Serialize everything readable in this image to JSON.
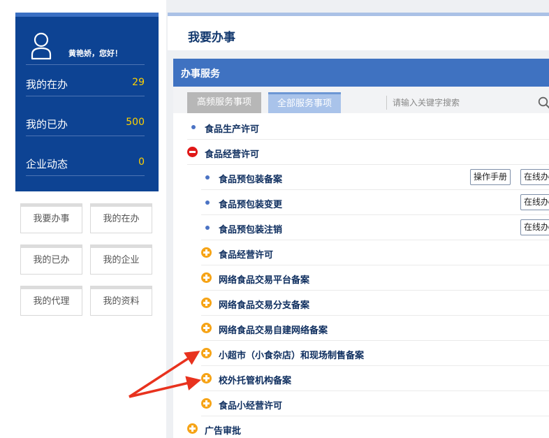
{
  "user": {
    "greeting": "黄艳娇，您好！",
    "stats": [
      {
        "label": "我的在办",
        "value": "29"
      },
      {
        "label": "我的已办",
        "value": "500"
      },
      {
        "label": "企业动态",
        "value": "0"
      }
    ]
  },
  "nav_buttons": [
    "我要办事",
    "我的在办",
    "我的已办",
    "我的企业",
    "我的代理",
    "我的资料"
  ],
  "page_title": "我要办事",
  "panel": {
    "title": "办事服务",
    "tabs": [
      {
        "label": "高频服务事项",
        "active": false
      },
      {
        "label": "全部服务事项",
        "active": true
      }
    ],
    "search_placeholder": "请输入关键字搜索"
  },
  "tree": [
    {
      "label": "食品生产许可",
      "type": "dot",
      "level": 0,
      "buttons": []
    },
    {
      "label": "食品经营许可",
      "type": "minus",
      "level": 0,
      "buttons": []
    },
    {
      "label": "食品预包装备案",
      "type": "dot",
      "level": 1,
      "buttons": [
        "操作手册",
        "在线办理"
      ]
    },
    {
      "label": "食品预包装变更",
      "type": "dot",
      "level": 1,
      "buttons": [
        "在线办理"
      ]
    },
    {
      "label": "食品预包装注销",
      "type": "dot",
      "level": 1,
      "buttons": [
        "在线办理"
      ]
    },
    {
      "label": "食品经营许可",
      "type": "plus",
      "level": 1,
      "buttons": []
    },
    {
      "label": "网络食品交易平台备案",
      "type": "plus",
      "level": 1,
      "buttons": []
    },
    {
      "label": "网络食品交易分支备案",
      "type": "plus",
      "level": 1,
      "buttons": []
    },
    {
      "label": "网络食品交易自建网络备案",
      "type": "plus",
      "level": 1,
      "buttons": []
    },
    {
      "label": "小超市（小食杂店）和现场制售备案",
      "type": "plus",
      "level": 1,
      "buttons": []
    },
    {
      "label": "校外托管机构备案",
      "type": "plus",
      "level": 1,
      "buttons": []
    },
    {
      "label": "食品小经营许可",
      "type": "plus",
      "level": 1,
      "buttons": []
    },
    {
      "label": "广告审批",
      "type": "plus",
      "level": 0,
      "buttons": []
    }
  ],
  "icons": {
    "avatar": "user-outline-icon",
    "search": "magnifier-icon",
    "dot": "bullet-dot-icon",
    "plus": "expand-plus-icon",
    "minus": "collapse-minus-icon"
  },
  "colors": {
    "sidebar_bg": "#0d4393",
    "stat_value": "#ffd200",
    "panel_header": "#3f72c1",
    "plus_icon": "#f6a417",
    "minus_icon": "#e01818",
    "dot": "#4b73c4",
    "annotation_arrow": "#e8321e"
  }
}
